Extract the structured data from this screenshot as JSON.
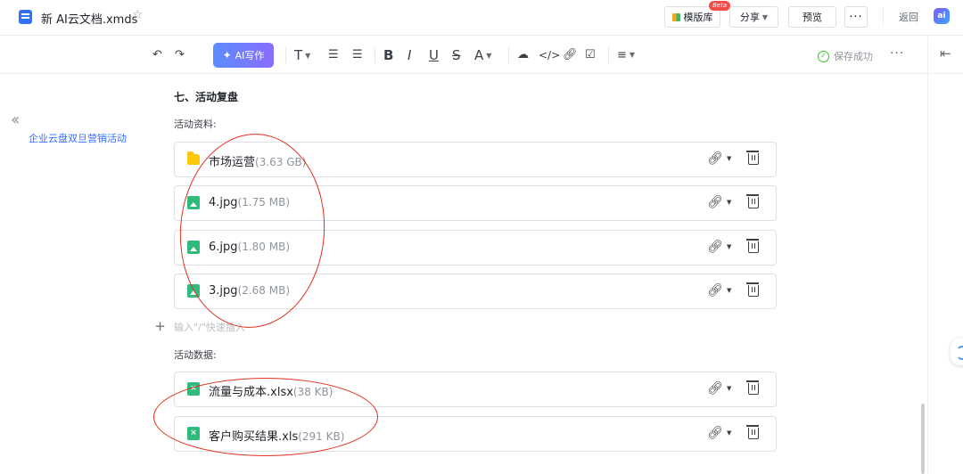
{
  "header": {
    "doc_title": "新 AI云文档.xmds",
    "template_label": "模版库",
    "beta_label": "Beta",
    "share_label": "分享",
    "preview_label": "预览",
    "more_label": "···",
    "back_label": "返回",
    "ai_logo_text": "ai"
  },
  "toolbar": {
    "ai_write_label": "AI写作",
    "text_style_label": "T",
    "bold_label": "B",
    "italic_label": "I",
    "underline_label": "U",
    "strike_label": "S",
    "font_color_label": "A",
    "status_label": "保存成功",
    "more_label": "···"
  },
  "outline": {
    "items": [
      "企业云盘双旦营销活动"
    ]
  },
  "content": {
    "heading": "七、活动复盘",
    "section1_label": "活动资料:",
    "section1_files": [
      {
        "name": "市场运营",
        "size": "(3.63 GB)",
        "type": "folder"
      },
      {
        "name": "4.jpg",
        "size": "(1.75 MB)",
        "type": "image"
      },
      {
        "name": "6.jpg",
        "size": "(1.80 MB)",
        "type": "image"
      },
      {
        "name": "3.jpg",
        "size": "(2.68 MB)",
        "type": "image"
      }
    ],
    "placeholder": "输入\"/\"快速插入",
    "section2_label": "活动数据:",
    "section2_files": [
      {
        "name": "流量与成本.xlsx",
        "size": "(38 KB)",
        "type": "excel"
      },
      {
        "name": "客户购买结果.xls",
        "size": "(291 KB)",
        "type": "excel"
      }
    ]
  },
  "colors": {
    "accent": "#3370ff",
    "annotation": "#e0301e",
    "file_green": "#2fbb7b",
    "folder_yellow": "#ffc60a"
  }
}
